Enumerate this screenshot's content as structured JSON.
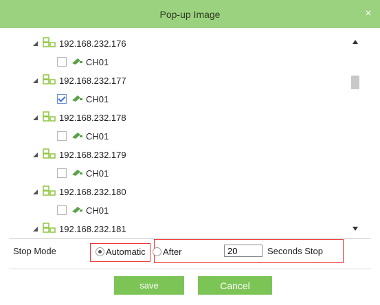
{
  "dialog": {
    "title": "Pop-up Image",
    "close_glyph": "×"
  },
  "tree": {
    "devices": [
      {
        "ip": "192.168.232.176",
        "channel": "CH01",
        "checked": false
      },
      {
        "ip": "192.168.232.177",
        "channel": "CH01",
        "checked": true
      },
      {
        "ip": "192.168.232.178",
        "channel": "CH01",
        "checked": false
      },
      {
        "ip": "192.168.232.179",
        "channel": "CH01",
        "checked": false
      },
      {
        "ip": "192.168.232.180",
        "channel": "CH01",
        "checked": false
      },
      {
        "ip": "192.168.232.181"
      }
    ]
  },
  "stop_mode": {
    "label": "Stop Mode",
    "automatic_label": "Automatic",
    "after_label": "After",
    "seconds_value": "20",
    "seconds_label": "Seconds Stop",
    "selected": "automatic"
  },
  "buttons": {
    "save_label": "save",
    "cancel_label": "Cancel"
  },
  "colors": {
    "title_bar": "#9bd27f",
    "button": "#7cc456",
    "highlight_box": "#ee3333",
    "device_icon": "#8dc63f",
    "camera_icon": "#5ba04a"
  }
}
